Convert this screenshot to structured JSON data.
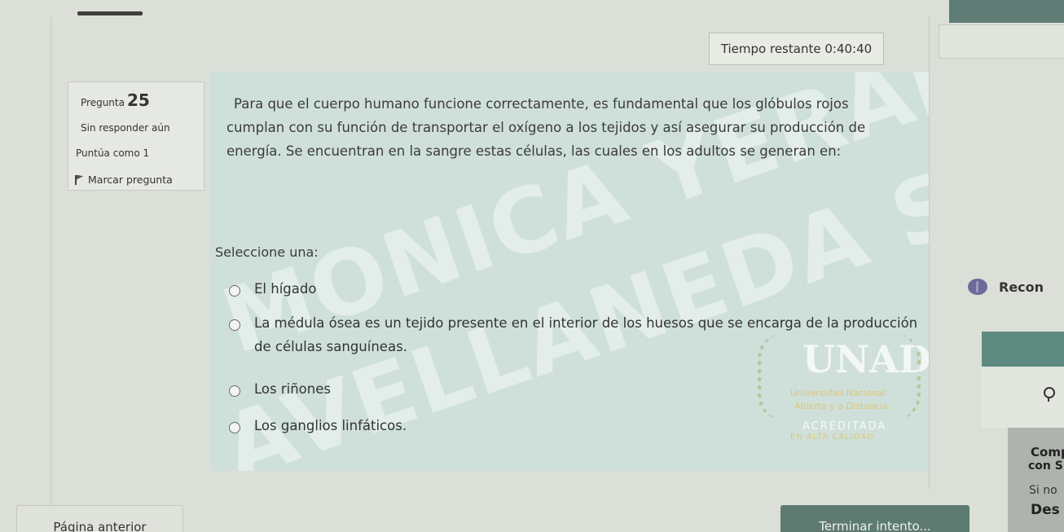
{
  "timer": {
    "label": "Tiempo restante",
    "value": "0:40:40"
  },
  "question_info": {
    "label": "Pregunta",
    "number": "25",
    "state": "Sin responder aún",
    "score": "Puntúa como 1",
    "flag_label": "Marcar pregunta"
  },
  "question": {
    "text": "Para que el cuerpo humano funcione correctamente, es fundamental que los glóbulos rojos cumplan con su función de transportar el oxígeno a los tejidos y así asegurar su producción de energía. Se encuentran en la sangre estas células, las cuales en los adultos se generan en:",
    "prompt": "Seleccione una:",
    "options": [
      "El hígado",
      "La médula ósea es un tejido presente en el interior de los huesos que se encarga de la producción de células sanguíneas.",
      "Los riñones",
      "Los ganglios linfáticos."
    ]
  },
  "watermark": {
    "line1": "MONICA YERALDINE",
    "line2": "AVELLANEDA SOSA"
  },
  "logo": {
    "name": "UNAD",
    "line1": "Universidad Nacional",
    "line2": "Abierta y a Distancia",
    "line3": "ACREDITADA",
    "line4": "EN ALTA CALIDAD"
  },
  "right_panel": {
    "reconocer": "Recon",
    "comp": "Comp",
    "conS": "con S",
    "sino": "Si no",
    "des": "Des"
  },
  "buttons": {
    "prev": "Página anterior",
    "finish": "Terminar intento..."
  }
}
